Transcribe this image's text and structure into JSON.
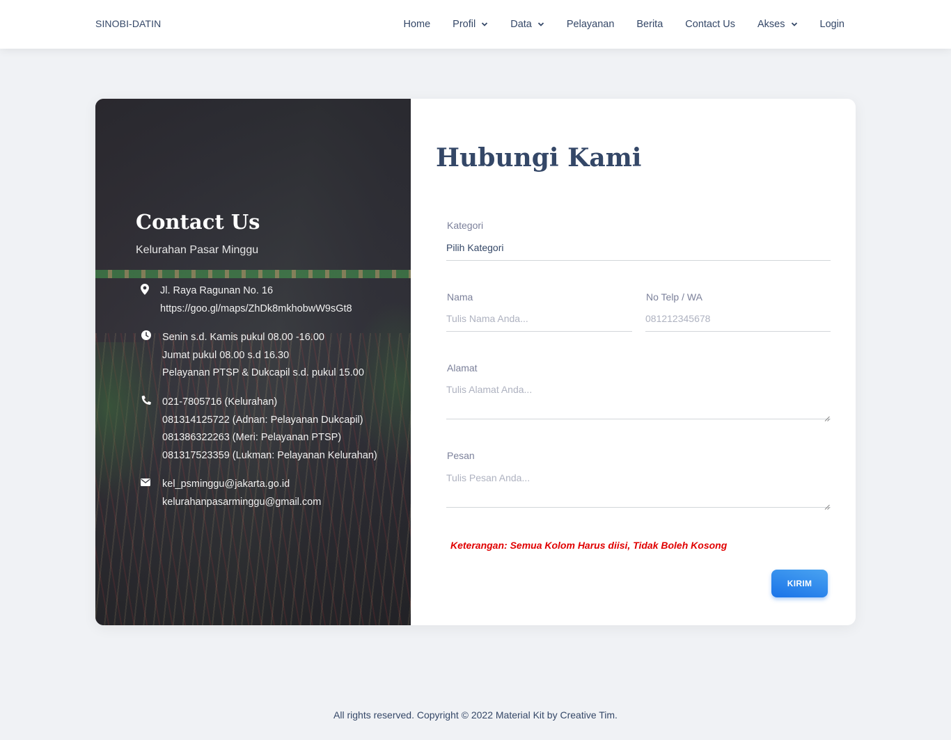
{
  "navbar": {
    "brand": "SINOBI-DATIN",
    "items": [
      {
        "label": "Home",
        "dropdown": false
      },
      {
        "label": "Profil",
        "dropdown": true
      },
      {
        "label": "Data",
        "dropdown": true
      },
      {
        "label": "Pelayanan",
        "dropdown": false
      },
      {
        "label": "Berita",
        "dropdown": false
      },
      {
        "label": "Contact Us",
        "dropdown": false
      },
      {
        "label": "Akses",
        "dropdown": true
      },
      {
        "label": "Login",
        "dropdown": false
      }
    ]
  },
  "contact_panel": {
    "title": "Contact Us",
    "subtitle": "Kelurahan Pasar Minggu",
    "address": {
      "icon": "map-pin-icon",
      "lines": [
        "Jl. Raya Ragunan No. 16",
        "https://goo.gl/maps/ZhDk8mkhobwW9sGt8"
      ]
    },
    "hours": {
      "icon": "clock-icon",
      "lines": [
        "Senin s.d. Kamis pukul 08.00 -16.00",
        "Jumat pukul 08.00 s.d 16.30",
        "Pelayanan PTSP & Dukcapil s.d. pukul 15.00"
      ]
    },
    "phones": {
      "icon": "phone-icon",
      "lines": [
        "021-7805716 (Kelurahan)",
        "081314125722 (Adnan: Pelayanan Dukcapil)",
        "081386322263 (Meri: Pelayanan PTSP)",
        "081317523359 (Lukman: Pelayanan Kelurahan)"
      ]
    },
    "emails": {
      "icon": "envelope-icon",
      "lines": [
        "kel_psminggu@jakarta.go.id",
        "kelurahanpasarminggu@gmail.com"
      ]
    }
  },
  "form": {
    "title": "Hubungi Kami",
    "kategori": {
      "label": "Kategori",
      "value": "Pilih Kategori"
    },
    "nama": {
      "label": "Nama",
      "placeholder": "Tulis Nama Anda..."
    },
    "telp": {
      "label": "No Telp / WA",
      "placeholder": "081212345678"
    },
    "alamat": {
      "label": "Alamat",
      "placeholder": "Tulis Alamat Anda..."
    },
    "pesan": {
      "label": "Pesan",
      "placeholder": "Tulis Pesan Anda..."
    },
    "note": "Keterangan: Semua Kolom Harus diisi, Tidak Boleh Kosong",
    "submit_label": "KIRIM"
  },
  "footer": {
    "text": "All rights reserved. Copyright © 2022 Material Kit by Creative Tim."
  },
  "colors": {
    "accent": "#1a73e8",
    "text": "#344767",
    "warning": "#e00000",
    "background": "#f0f2f5"
  }
}
